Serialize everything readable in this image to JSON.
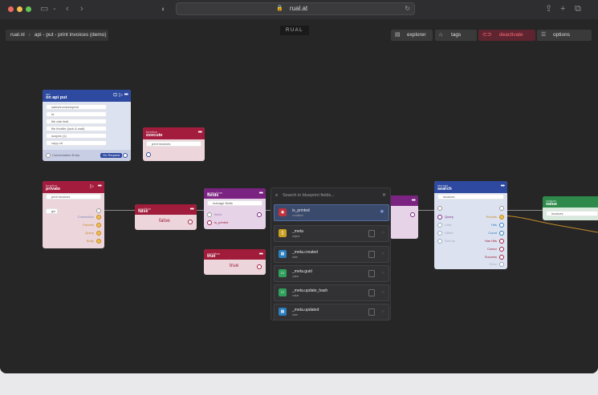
{
  "browser": {
    "url": "rual.at",
    "colors": {
      "close": "#ec6a5e",
      "minimize": "#f4bf4f",
      "maximize": "#61c554"
    }
  },
  "app": {
    "logo": "RUAL",
    "breadcrumb": {
      "root": "rual.nl",
      "page": "api - put - print invoices (demo)"
    },
    "toolbar": {
      "explorer": "explorer",
      "tags": "tags",
      "deactivate": "deactivate",
      "options": "options"
    }
  },
  "nodes": {
    "api": {
      "kind": "api",
      "title": "on api put",
      "fields": [
        "sales/invoices/print",
        "id",
        "file rate limit",
        "file throttle (lock & wait)",
        "scopes (1)",
        "copy url"
      ],
      "footer_left": "Conversation Entry",
      "footer_right": "On Request",
      "color": "#2e4aa0"
    },
    "execute": {
      "kind": "function",
      "title": "execute",
      "field": "print invoices",
      "color": "#a31c3e"
    },
    "private": {
      "kind": "function",
      "title": "private",
      "field": "print invoices",
      "input": "gin",
      "outputs": [
        "Connection",
        "Params",
        "Query",
        "Body"
      ],
      "color": "#a31c3e"
    },
    "cond_false": {
      "kind": "condition",
      "title": "false",
      "value": "false",
      "color": "#a01c3a"
    },
    "cond_true": {
      "kind": "condition",
      "title": "true",
      "value": "true",
      "color": "#a01c3a"
    },
    "fields": {
      "kind": "query form",
      "title": "fields",
      "field": "manage fields",
      "ports": [
        "fields",
        "is_printed"
      ],
      "color": "#7a2380"
    },
    "search": {
      "kind": "storage",
      "title": "search",
      "field": "invoices",
      "inputs": [
        "Query",
        "Limit",
        "Offset",
        "Sort by"
      ],
      "outputs": [
        "Results",
        "Hits",
        "Count",
        "Has Hits",
        "Cursor",
        "Success",
        "Error"
      ],
      "color": "#2e4aa0"
    },
    "value": {
      "kind": "custom",
      "title": "value",
      "field": "invoices",
      "color": "#2e8a4a"
    }
  },
  "picker": {
    "placeholder": "Search in blueprint fields...",
    "items": [
      {
        "name": "is_printed",
        "type": "condition",
        "icon_color": "#c0323c",
        "selected": true
      },
      {
        "name": "_meta",
        "type": "object",
        "icon_color": "#c8a022",
        "selected": false
      },
      {
        "name": "_meta.created",
        "type": "date",
        "icon_color": "#2a7fbe",
        "selected": false
      },
      {
        "name": "_meta.guid",
        "type": "value",
        "icon_color": "#2fa05c",
        "selected": false
      },
      {
        "name": "_meta.update_hash",
        "type": "value",
        "icon_color": "#2fa05c",
        "selected": false
      },
      {
        "name": "_meta.updated",
        "type": "date",
        "icon_color": "#2a7fbe",
        "selected": false
      }
    ]
  }
}
